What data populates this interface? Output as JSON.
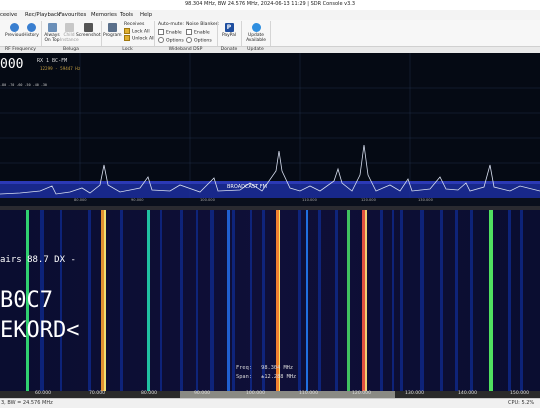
{
  "window": {
    "title": "98.304 MHz, BW 24.576 MHz, 2024-06-13 11:29 | SDR Console v3.3"
  },
  "menu": [
    "ceeive",
    "Rec/Playback",
    "Favourites",
    "Memories",
    "Tools",
    "Help"
  ],
  "ribbon": {
    "buttons": [
      "Previous",
      "History",
      "Always On Top",
      "Child Instance",
      "Screenshot",
      "Program",
      "PayPal",
      "Update Available"
    ],
    "lock": {
      "heading": "Receives",
      "lock_all": "Lock All",
      "unlock_all": "Unlock All"
    },
    "automute": {
      "heading": "Auto-mute:",
      "enable": "Enable",
      "options": "Options"
    },
    "noise": {
      "heading": "Noise Blanker:",
      "enable": "Enable",
      "options": "Options"
    },
    "groups": [
      "RF Frequency",
      "Beluga",
      "Lock",
      "Wideband DSP",
      "Donate",
      "Update"
    ]
  },
  "spectrum": {
    "frequency": "000",
    "rx": "RX 1  BC-FM",
    "rx_sub": "12299 - 59447 Hz",
    "smeter": "-80  -70  -60  -50  -40  -30",
    "axis": [
      "80.000",
      "90.000",
      "100.000",
      "110.000",
      "120.000",
      "130.000"
    ],
    "band_label": "BROADCAST FM"
  },
  "waterfall": {
    "rds_line": "airs  88.7  DX  -",
    "rds_code": "B0C7",
    "rds_text": "EKORD<",
    "freq_label": "Freq:",
    "freq_value": "98.304 MHz",
    "span_label": "Span:",
    "span_value": "±12.288 MHz"
  },
  "bottom_scale": [
    "60.000",
    "70.000",
    "80.000",
    "90.000",
    "100.000",
    "110.000",
    "120.000",
    "130.000",
    "140.000",
    "150.000"
  ],
  "status": {
    "left": "3, BW = 24.576 MHz",
    "cpu": "CPU: 5.2%"
  }
}
